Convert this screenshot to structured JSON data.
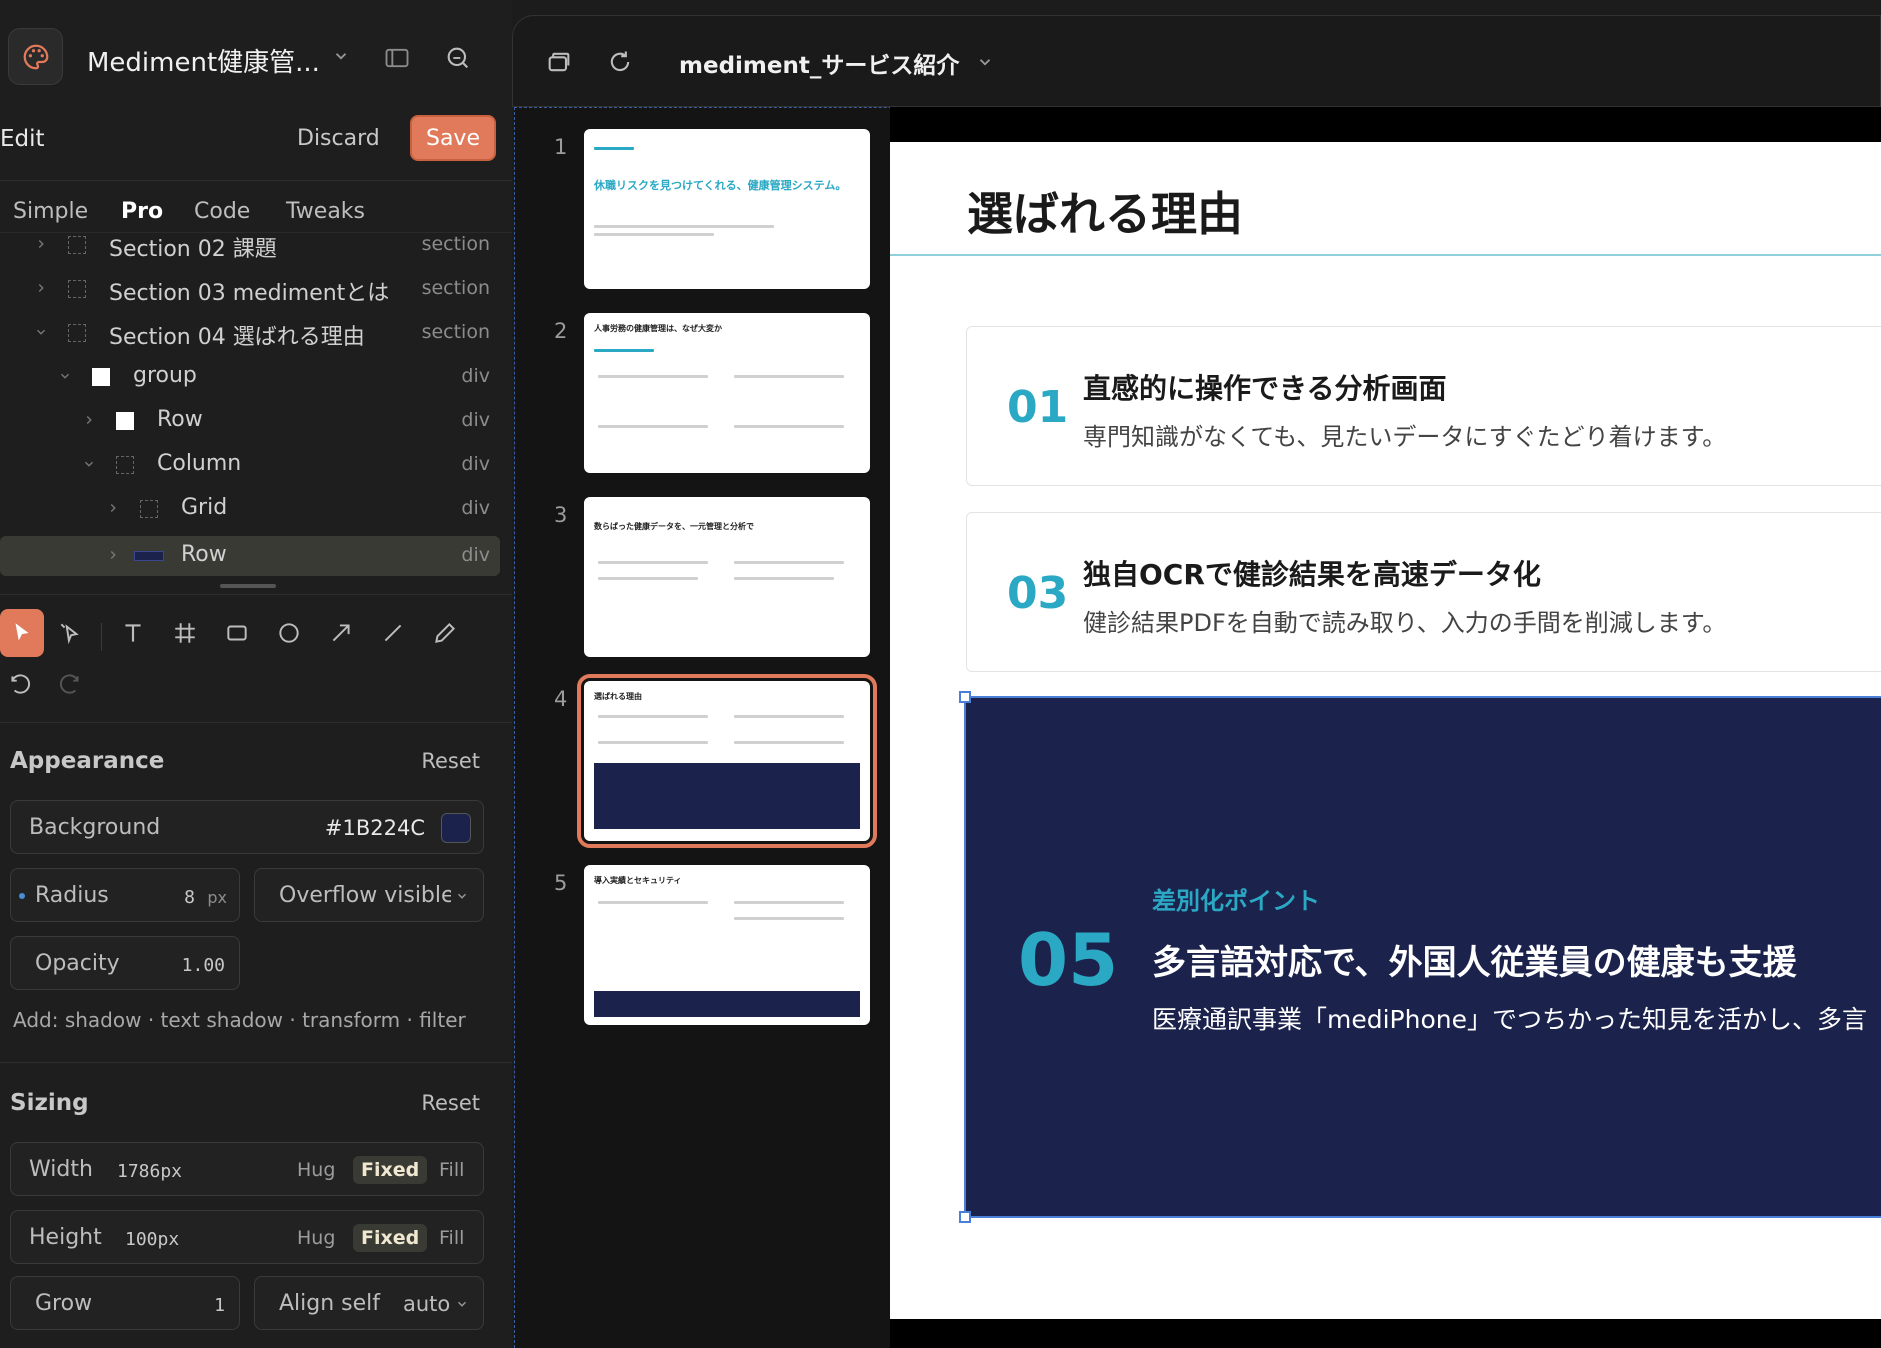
{
  "project": {
    "name": "Mediment健康管..."
  },
  "edit": {
    "title": "Edit",
    "discard": "Discard",
    "save": "Save"
  },
  "mode_tabs": [
    "Simple",
    "Pro",
    "Code",
    "Tweaks"
  ],
  "layers": [
    {
      "name": "Section  02 課題",
      "type": "section"
    },
    {
      "name": "Section  03 medimentとは",
      "type": "section"
    },
    {
      "name": "Section  04 選ばれる理由",
      "type": "section"
    },
    {
      "name": "group",
      "type": "div"
    },
    {
      "name": "Row",
      "type": "div"
    },
    {
      "name": "Column",
      "type": "div"
    },
    {
      "name": "Grid",
      "type": "div"
    },
    {
      "name": "Row",
      "type": "div"
    }
  ],
  "appearance": {
    "title": "Appearance",
    "reset": "Reset",
    "background_label": "Background",
    "background_value": "#1B224C",
    "radius_label": "Radius",
    "radius_value": "8",
    "radius_unit": "px",
    "overflow_value": "Overflow visible",
    "opacity_label": "Opacity",
    "opacity_value": "1.00",
    "add_line": "Add: shadow · text shadow · transform · filter"
  },
  "sizing": {
    "title": "Sizing",
    "reset": "Reset",
    "width_label": "Width",
    "width_value": "1786px",
    "height_label": "Height",
    "height_value": "100px",
    "hug": "Hug",
    "fixed": "Fixed",
    "fill": "Fill",
    "grow_label": "Grow",
    "grow_value": "1",
    "align_label": "Align self",
    "align_value": "auto"
  },
  "document": {
    "title": "mediment_サービス紹介"
  },
  "thumbnails": [
    {
      "num": "1",
      "title": "休職リスクを見つけてくれる、健康管理システム。"
    },
    {
      "num": "2",
      "title": "人事労務の健康管理は、なぜ大変か"
    },
    {
      "num": "3",
      "title": "数らばった健康データを、一元管理と分析で"
    },
    {
      "num": "4",
      "title": "選ばれる理由"
    },
    {
      "num": "5",
      "title": "導入実績とセキュリティ"
    }
  ],
  "slide": {
    "title": "選ばれる理由",
    "cards": [
      {
        "num": "01",
        "heading": "直感的に操作できる分析画面",
        "text": "専門知識がなくても、見たいデータにすぐたどり着けます。"
      },
      {
        "num": "03",
        "heading": "独自OCRで健診結果を高速データ化",
        "text": "健診結果PDFを自動で読み取り、入力の手間を削減します。"
      }
    ],
    "feature": {
      "num": "05",
      "kicker": "差別化ポイント",
      "heading": "多言語対応で、外国人従業員の健康も支援",
      "text": "医療通訳事業「mediPhone」でつちかった知見を活かし、多言"
    }
  },
  "colors": {
    "accent": "#e07a5a",
    "navy": "#1B224C",
    "teal": "#2aa8c4",
    "selection": "#4a7fd8"
  }
}
